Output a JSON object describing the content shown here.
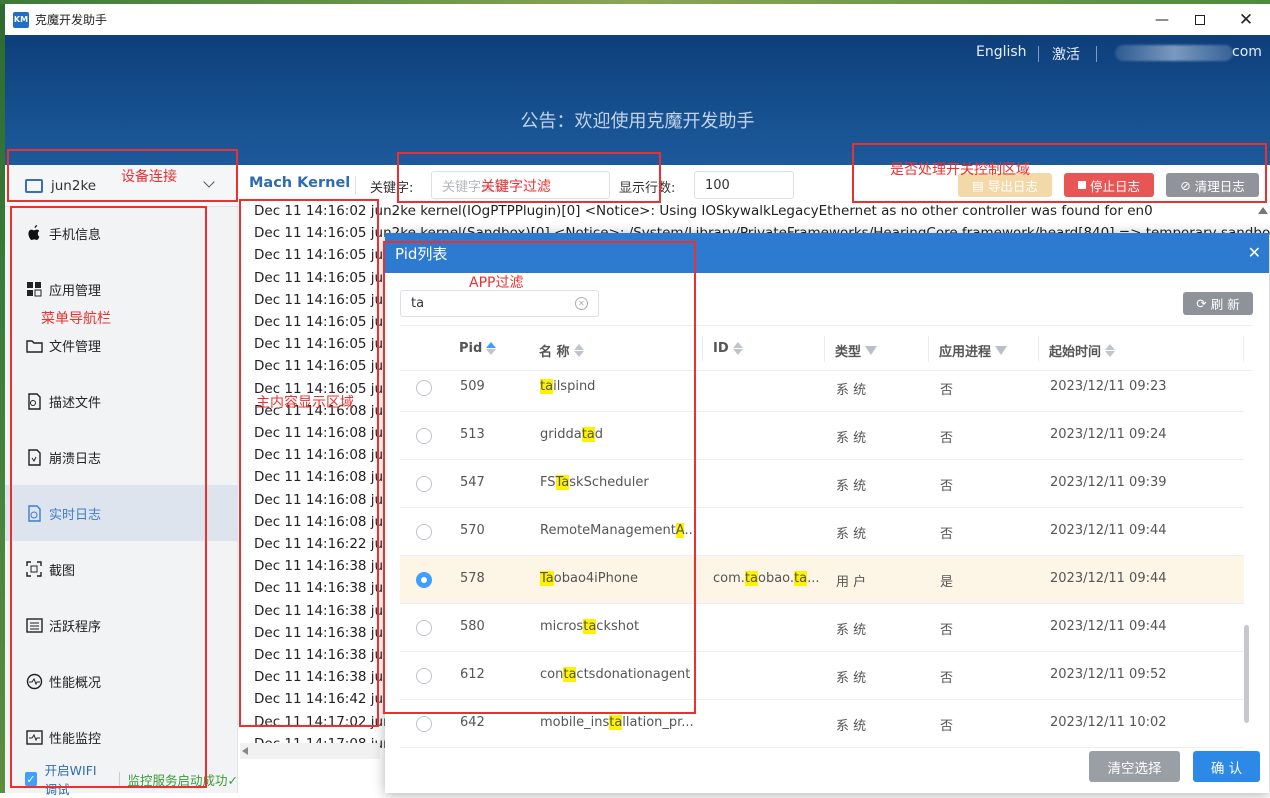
{
  "window": {
    "title": "克魔开发助手",
    "icon": "KM",
    "controls": [
      "minimize-icon",
      "maximize-icon",
      "close-icon"
    ]
  },
  "header": {
    "english": "English",
    "activate": "激活",
    "account": "com",
    "announcement": "公告：欢迎使用克魔开发助手"
  },
  "device": {
    "name": "jun2ke"
  },
  "sidebar": {
    "items": [
      {
        "label": "手机信息",
        "icon": "apple-icon"
      },
      {
        "label": "应用管理",
        "icon": "apps-grid-icon"
      },
      {
        "label": "文件管理",
        "icon": "folder-icon"
      },
      {
        "label": "描述文件",
        "icon": "profile-file-icon"
      },
      {
        "label": "崩溃日志",
        "icon": "crash-log-icon"
      },
      {
        "label": "实时日志",
        "icon": "realtime-log-icon"
      },
      {
        "label": "截图",
        "icon": "screenshot-icon"
      },
      {
        "label": "活跃程序",
        "icon": "active-programs-icon"
      },
      {
        "label": "性能概况",
        "icon": "performance-icon"
      },
      {
        "label": "性能监控",
        "icon": "monitor-icon"
      }
    ],
    "active_index": 5,
    "wifi_label": "开启WIFI调试",
    "service_status": "监控服务启动成功✓"
  },
  "toolbar": {
    "title": "Mach Kernel",
    "keyword_label": "关键字:",
    "keyword_placeholder": "关键字过滤",
    "rows_label": "显示行数:",
    "rows_value": "100",
    "export_btn": "导出日志",
    "stop_btn": "停止日志",
    "clear_btn": "清理日志"
  },
  "log": {
    "lines": [
      "Dec 11 14:16:02 jun2ke kernel(IOgPTPPlugin)[0] <Notice>: Using IOSkywalkLegacyEthernet as no other controller was found for en0",
      "Dec 11 14:16:05 jun2ke kernel(Sandbox)[0] <Notice>: /System/Library/PrivateFrameworks/HearingCore.framework/heard[840] => temporary sandbox",
      "Dec 11 14:16:05 jun2",
      "Dec 11 14:16:05 jun2",
      "Dec 11 14:16:05 jun2",
      "Dec 11 14:16:05 jun2",
      "Dec 11 14:16:05 jun2",
      "Dec 11 14:16:05 jun2",
      "Dec 11 14:16:05 jun2",
      "Dec 11 14:16:08 jun2",
      "Dec 11 14:16:08 jun2",
      "Dec 11 14:16:08 jun2",
      "Dec 11 14:16:08 jun2",
      "Dec 11 14:16:08 jun2",
      "Dec 11 14:16:08 jun2",
      "Dec 11 14:16:22 jun2",
      "Dec 11 14:16:38 jun2",
      "Dec 11 14:16:38 jun2",
      "Dec 11 14:16:38 jun2",
      "Dec 11 14:16:38 jun2",
      "Dec 11 14:16:38 jun2",
      "Dec 11 14:16:38 jun2",
      "Dec 11 14:16:42 jun2",
      "Dec 11 14:17:02 jun2",
      "Dec 11 14:17:08 jun2"
    ]
  },
  "dialog": {
    "title": "Pid列表",
    "search_value": "ta",
    "refresh": "刷 新",
    "columns": [
      "Pid",
      "名 称",
      "ID",
      "类型",
      "应用进程",
      "起始时间"
    ],
    "rows": [
      {
        "pid": "509",
        "name": [
          [
            "ta",
            true
          ],
          [
            "ilspind",
            false
          ]
        ],
        "id": [],
        "type": "系 统",
        "app": "否",
        "time": "2023/12/11 09:23",
        "selected": false
      },
      {
        "pid": "513",
        "name": [
          [
            "gridda",
            false
          ],
          [
            "ta",
            true
          ],
          [
            "d",
            false
          ]
        ],
        "id": [],
        "type": "系 统",
        "app": "否",
        "time": "2023/12/11 09:24",
        "selected": false
      },
      {
        "pid": "547",
        "name": [
          [
            "FS",
            false
          ],
          [
            "Ta",
            true
          ],
          [
            "skScheduler",
            false
          ]
        ],
        "id": [],
        "type": "系 统",
        "app": "否",
        "time": "2023/12/11 09:39",
        "selected": false
      },
      {
        "pid": "570",
        "name": [
          [
            "RemoteManagement",
            false
          ],
          [
            "A",
            true
          ],
          [
            "...",
            false
          ]
        ],
        "id": [],
        "type": "系 统",
        "app": "否",
        "time": "2023/12/11 09:44",
        "selected": false
      },
      {
        "pid": "578",
        "name": [
          [
            "Ta",
            true
          ],
          [
            "obao4iPhone",
            false
          ]
        ],
        "id": [
          [
            "com.",
            false
          ],
          [
            "ta",
            true
          ],
          [
            "obao.",
            false
          ],
          [
            "ta",
            true
          ],
          [
            "...",
            false
          ]
        ],
        "type": "用 户",
        "app": "是",
        "time": "2023/12/11 09:44",
        "selected": true
      },
      {
        "pid": "580",
        "name": [
          [
            "micros",
            false
          ],
          [
            "ta",
            true
          ],
          [
            "ckshot",
            false
          ]
        ],
        "id": [],
        "type": "系 统",
        "app": "否",
        "time": "2023/12/11 09:44",
        "selected": false
      },
      {
        "pid": "612",
        "name": [
          [
            "con",
            false
          ],
          [
            "ta",
            true
          ],
          [
            "ctsdonationagent",
            false
          ]
        ],
        "id": [],
        "type": "系 统",
        "app": "否",
        "time": "2023/12/11 09:52",
        "selected": false
      },
      {
        "pid": "642",
        "name": [
          [
            "mobile_ins",
            false
          ],
          [
            "ta",
            true
          ],
          [
            "llation_pr...",
            false
          ]
        ],
        "id": [],
        "type": "系 统",
        "app": "否",
        "time": "2023/12/11 10:02",
        "selected": false
      }
    ],
    "clear_btn": "清空选择",
    "ok_btn": "确 认"
  },
  "annotations": {
    "device_connect": "设备连接",
    "menu_nav": "菜单导航栏",
    "keyword_filter": "关键字过滤",
    "switch_control": "是否处理开关控制区域",
    "content_area": "主内容显示区域",
    "app_filter": "APP过滤"
  },
  "colors": {
    "header": "#16508f",
    "accent": "#2d7bd1",
    "annotation": "#ec3030",
    "highlight": "#fff200"
  }
}
